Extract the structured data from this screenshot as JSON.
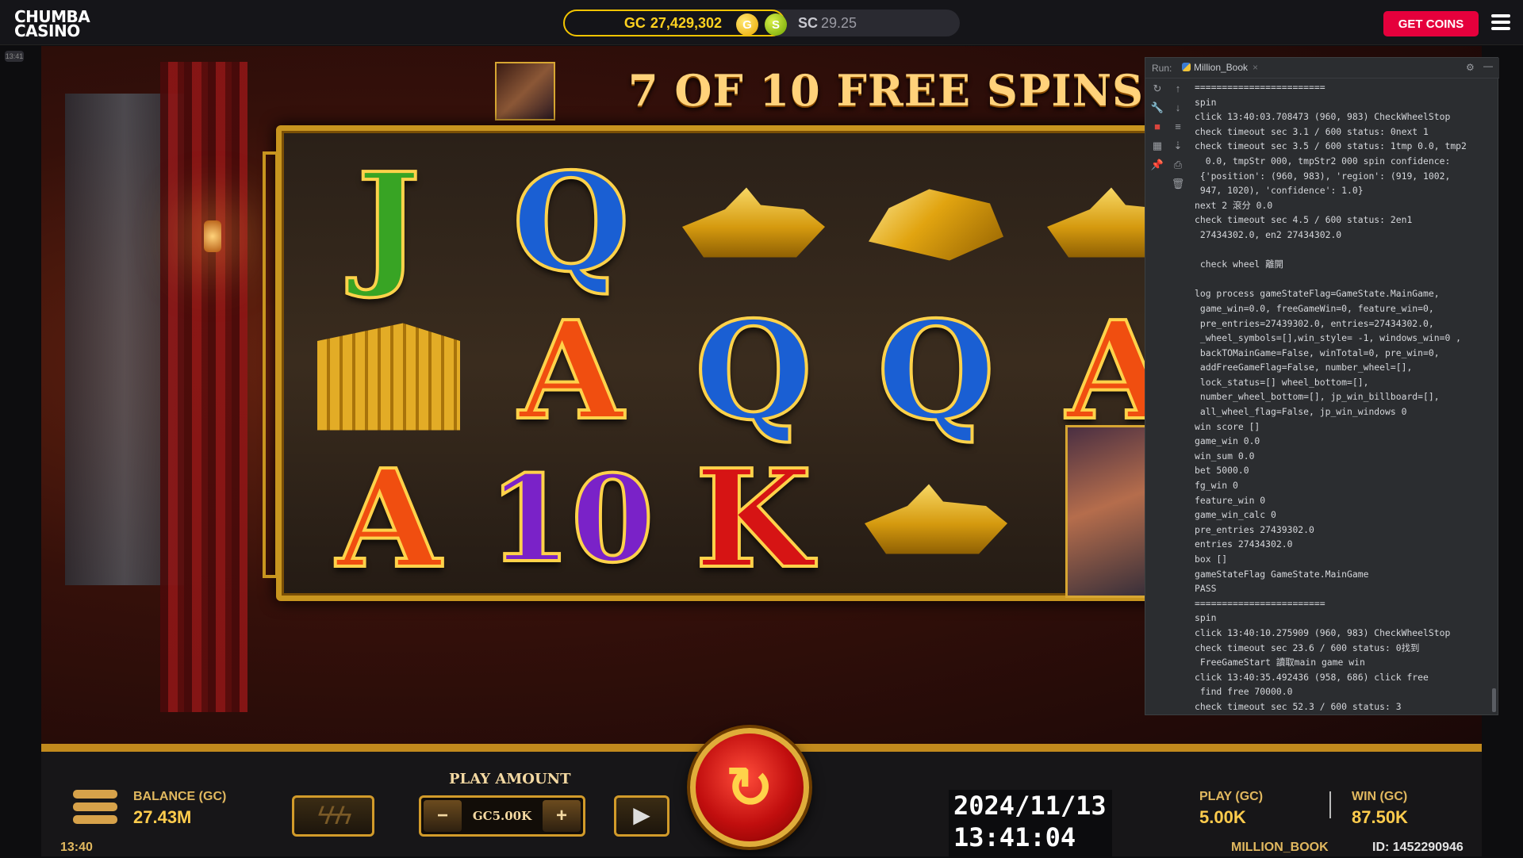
{
  "topbar": {
    "logo_line1": "CHUMBA",
    "logo_line2": "CASINO",
    "gc_label": "GC",
    "gc_value": "27,429,302",
    "coin_g": "G",
    "coin_s": "S",
    "sc_label": "SC",
    "sc_value": "29.25",
    "get_coins_label": "GET COINS",
    "time_tag": "13:41",
    "accent_color": "#e5003c",
    "gold_color": "#f2c400"
  },
  "game": {
    "banner": "7 OF 10 FREE SPINS",
    "grid": [
      [
        "J",
        "Q",
        "yacht",
        "gold-bars",
        "yacht"
      ],
      [
        "house",
        "A",
        "Q",
        "Q",
        "A"
      ],
      [
        "A",
        "10",
        "K",
        "yacht",
        "couple"
      ]
    ]
  },
  "controls": {
    "balance_label": "BALANCE (GC)",
    "balance_value": "27.43M",
    "clock": "13:40",
    "play_amount_label": "PLAY AMOUNT",
    "stake_value": "GC5.00K",
    "minus": "−",
    "plus": "+",
    "date": "2024/11/13",
    "time": "13:41:04",
    "play_label": "PLAY (GC)",
    "play_value": "5.00K",
    "win_label": "WIN (GC)",
    "win_value": "87.50K",
    "game_name": "MILLION_BOOK",
    "game_id": "ID: 1452290946"
  },
  "run_panel": {
    "label": "Run:",
    "tab": "Million_Book",
    "lines": [
      "========================",
      "spin",
      "click 13:40:03.708473 (960, 983) CheckWheelStop",
      "check timeout sec 3.1 / 600 status: 0next 1",
      "check timeout sec 3.5 / 600 status: 1tmp 0.0, tmp2",
      "  0.0, tmpStr 000, tmpStr2 000 spin confidence:",
      " {'position': (960, 983), 'region': (919, 1002,",
      " 947, 1020), 'confidence': 1.0}",
      "next 2 滾分 0.0",
      "check timeout sec 4.5 / 600 status: 2en1",
      " 27434302.0, en2 27434302.0",
      "",
      " check wheel 離開",
      "",
      "log process gameStateFlag=GameState.MainGame,",
      " game_win=0.0, freeGameWin=0, feature_win=0,",
      " pre_entries=27439302.0, entries=27434302.0,",
      " _wheel_symbols=[],win_style= -1, windows_win=0 ,",
      " backTOMainGame=False, winTotal=0, pre_win=0,",
      " addFreeGameFlag=False, number_wheel=[],",
      " lock_status=[] wheel_bottom=[],",
      " number_wheel_bottom=[], jp_win_billboard=[],",
      " all_wheel_flag=False, jp_win_windows 0",
      "win score []",
      "game_win 0.0",
      "win_sum 0.0",
      "bet 5000.0",
      "fg_win 0",
      "feature_win 0",
      "game_win_calc 0",
      "pre_entries 27439302.0",
      "entries 27434302.0",
      "box []",
      "gameStateFlag GameState.MainGame",
      "PASS",
      "========================",
      "spin",
      "click 13:40:10.275909 (960, 983) CheckWheelStop",
      "check timeout sec 23.6 / 600 status: 0找到",
      " FreeGameStart 讀取main game win",
      "click 13:40:35.492436 (958, 686) click free",
      " find free 70000.0",
      "check timeout sec 52.3 / 600 status: 3"
    ]
  }
}
